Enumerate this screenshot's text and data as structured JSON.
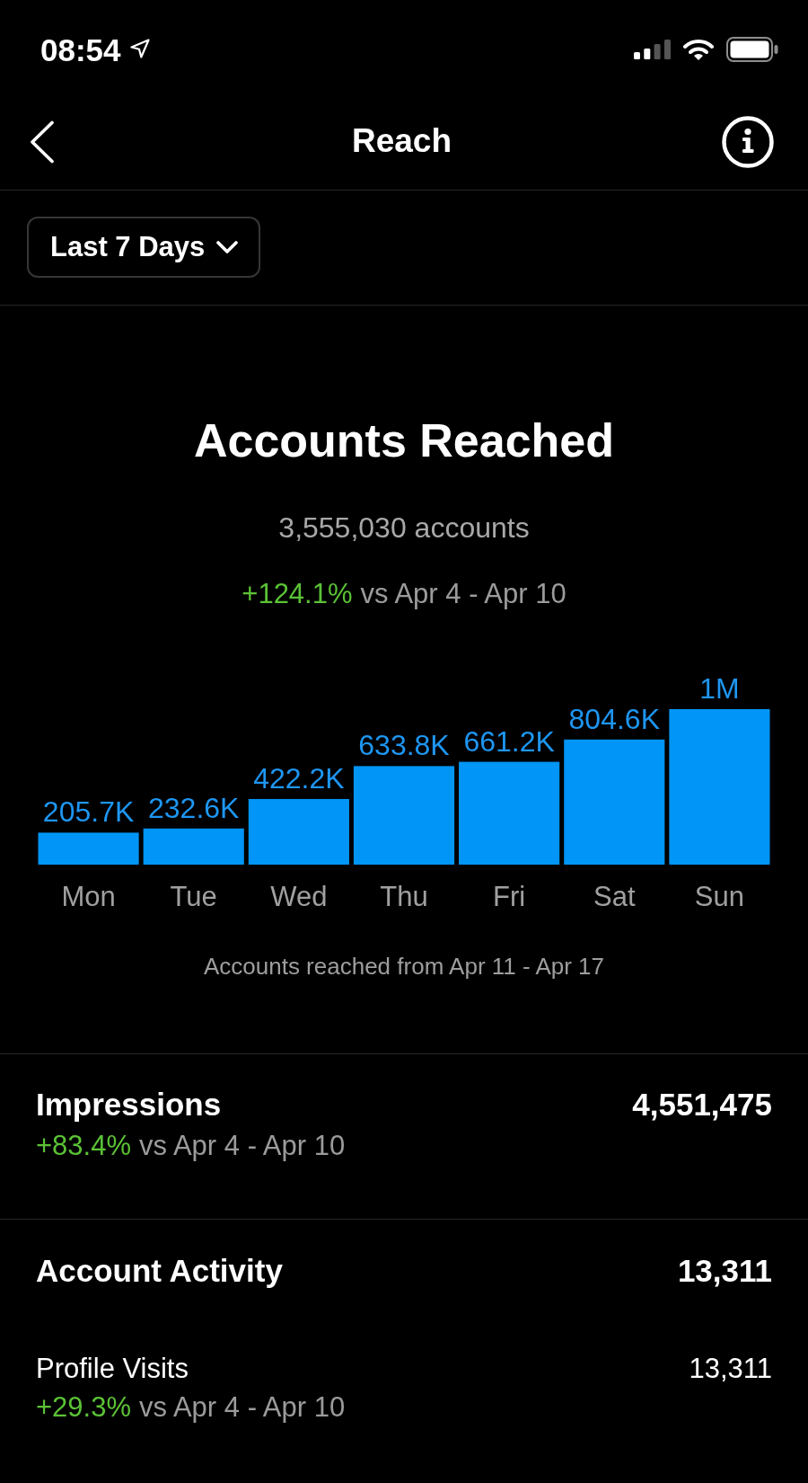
{
  "status_bar": {
    "time": "08:54"
  },
  "header": {
    "title": "Reach"
  },
  "filter": {
    "label": "Last 7 Days"
  },
  "reach": {
    "title": "Accounts Reached",
    "total": "3,555,030 accounts",
    "change": "+124.1%",
    "comparison": "vs Apr 4 - Apr 10",
    "chart_data": {
      "type": "bar",
      "categories": [
        "Mon",
        "Tue",
        "Wed",
        "Thu",
        "Fri",
        "Sat",
        "Sun"
      ],
      "values": [
        205700,
        232600,
        422200,
        633800,
        661200,
        804600,
        1000000
      ],
      "value_labels": [
        "205.7K",
        "232.6K",
        "422.2K",
        "633.8K",
        "661.2K",
        "804.6K",
        "1M"
      ],
      "xlabel": "Accounts reached from Apr 11 - Apr 17"
    }
  },
  "sections": [
    {
      "label": "Impressions",
      "value": "4,551,475",
      "change": "+83.4%",
      "comparison": "vs Apr 4 - Apr 10"
    },
    {
      "label": "Account Activity",
      "value": "13,311",
      "items": [
        {
          "label": "Profile Visits",
          "value": "13,311",
          "change": "+29.3%",
          "comparison": "vs Apr 4 - Apr 10"
        }
      ]
    }
  ]
}
